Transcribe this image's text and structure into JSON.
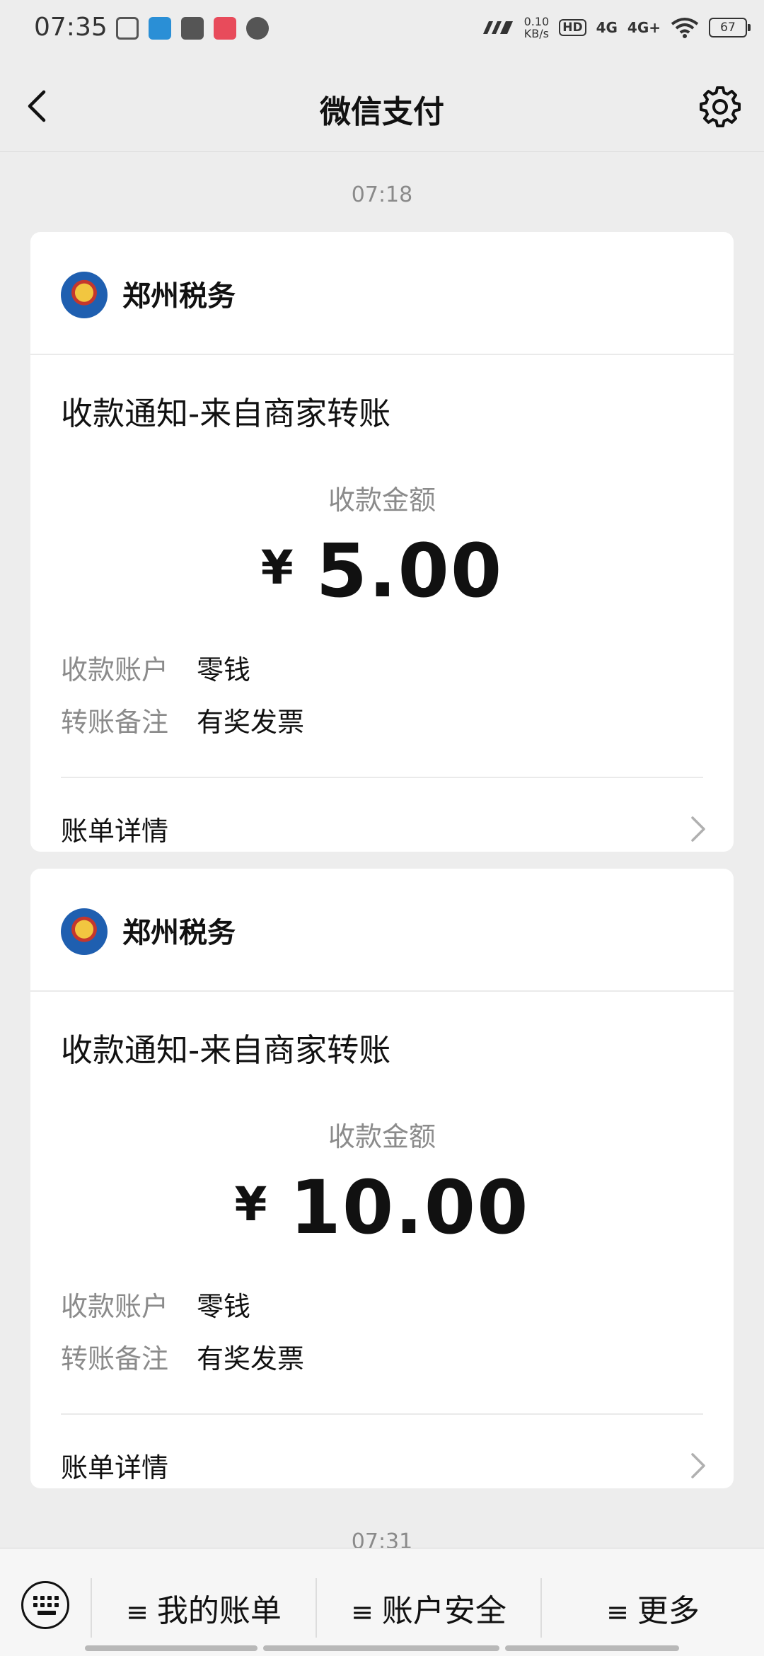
{
  "status_bar": {
    "time": "07:35",
    "net_speed_value": "0.10",
    "net_speed_unit": "KB/s",
    "hd_label": "HD",
    "net1": "4G",
    "net2": "4G+",
    "battery": "67",
    "notification_icons": [
      "app-icon-1",
      "app-icon-2",
      "telegram-icon",
      "app-icon-3",
      "chat-bubble-icon"
    ]
  },
  "nav": {
    "title": "微信支付",
    "back_icon": "chevron-left-icon",
    "settings_icon": "gear-icon"
  },
  "messages": [
    {
      "time": "07:18",
      "merchant": "郑州税务",
      "notice": "收款通知-来自商家转账",
      "amount_label": "收款金额",
      "currency": "¥",
      "amount": "5.00",
      "account_key": "收款账户",
      "account_value": "零钱",
      "remark_key": "转账备注",
      "remark_value": "有奖发票",
      "detail_label": "账单详情"
    },
    {
      "merchant": "郑州税务",
      "notice": "收款通知-来自商家转账",
      "amount_label": "收款金额",
      "currency": "¥",
      "amount": "10.00",
      "account_key": "收款账户",
      "account_value": "零钱",
      "remark_key": "转账备注",
      "remark_value": "有奖发票",
      "detail_label": "账单详情"
    }
  ],
  "next_time_partial": "07:31",
  "bottom_menu": {
    "keyboard_icon": "keyboard-icon",
    "items": [
      {
        "prefix": "≡",
        "label": "我的账单"
      },
      {
        "prefix": "≡",
        "label": "账户安全"
      },
      {
        "prefix": "≡",
        "label": "更多"
      }
    ]
  },
  "colors": {
    "background": "#ededed",
    "card": "#ffffff",
    "secondary_text": "#8b8b8b"
  }
}
